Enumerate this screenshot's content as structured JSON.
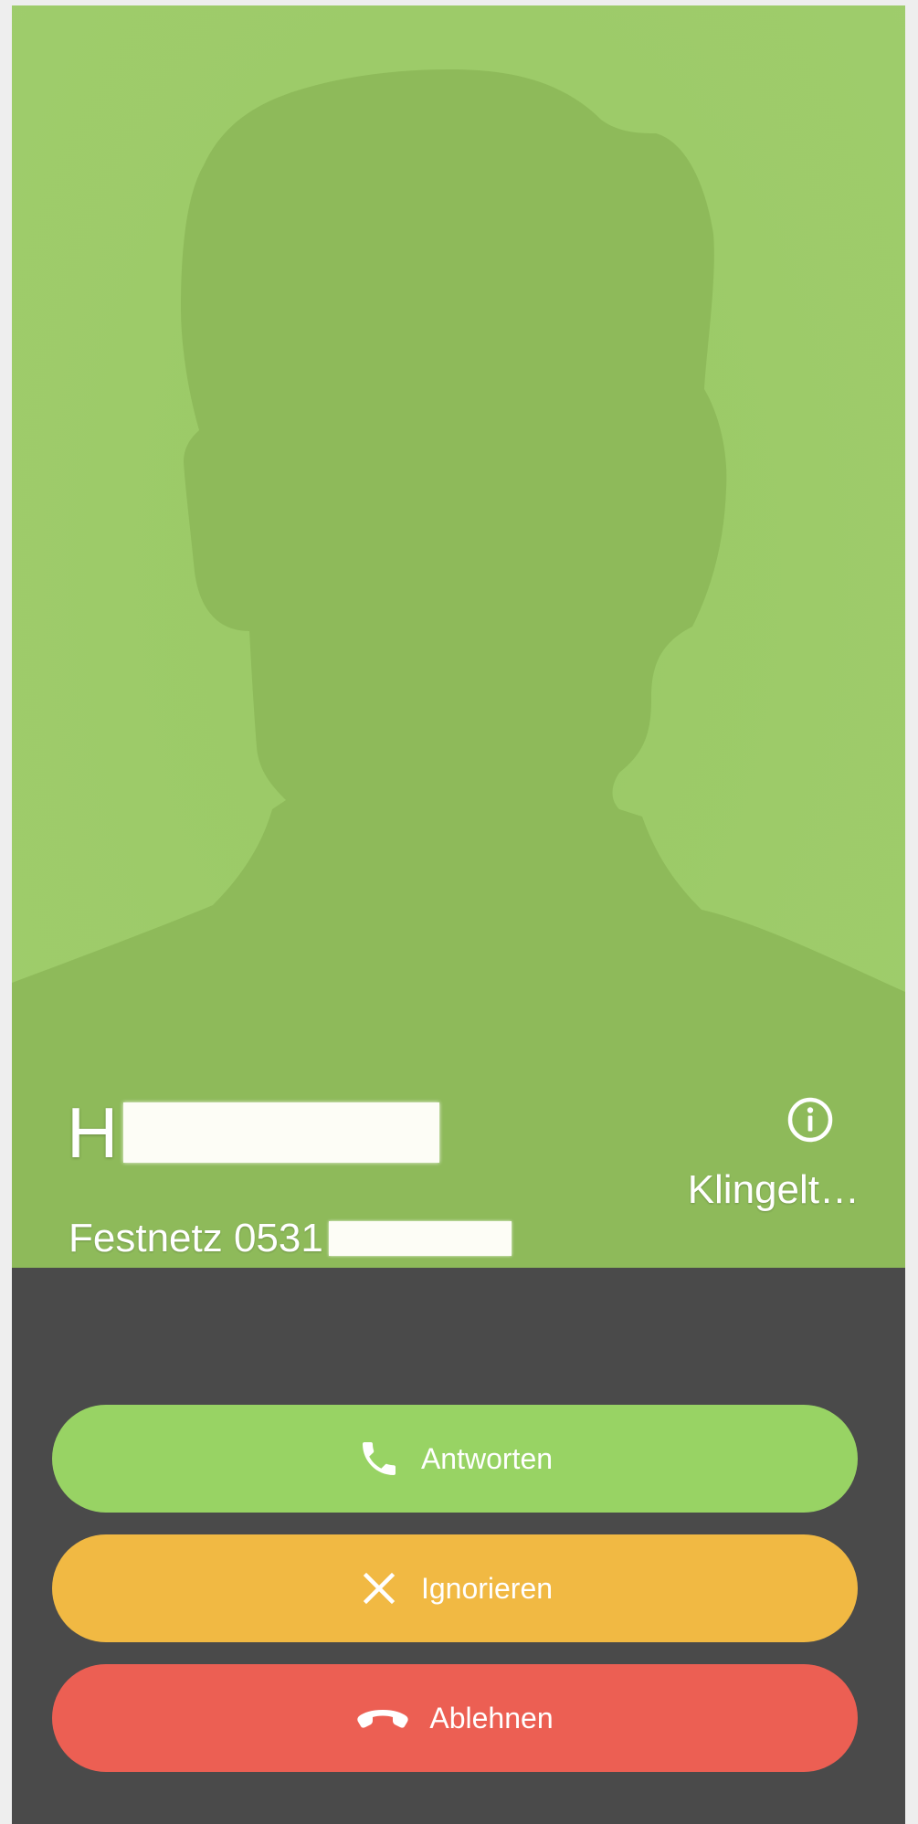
{
  "caller": {
    "name_initial": "H",
    "number": "Festnetz 0531",
    "status": "Klingelt…"
  },
  "actions": {
    "answer_label": "Antworten",
    "ignore_label": "Ignorieren",
    "decline_label": "Ablehnen"
  },
  "icons": {
    "info": "info-icon",
    "answer": "phone-icon",
    "ignore": "close-icon",
    "decline": "hang-up-icon",
    "avatar": "person-silhouette-icon"
  },
  "colors": {
    "photo_background": "#9dcb69",
    "silhouette": "#8eba5a",
    "panel_background": "#4a4a4a",
    "answer": "#98d364",
    "ignore": "#f1b943",
    "decline": "#ec5f53"
  }
}
